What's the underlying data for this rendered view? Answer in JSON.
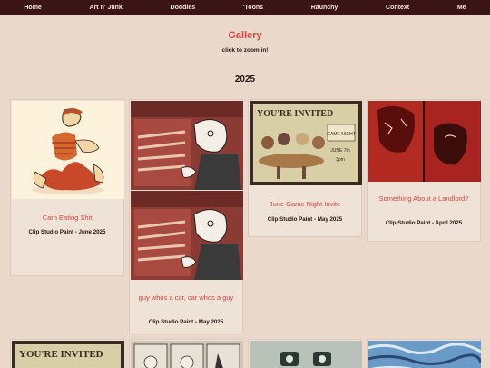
{
  "nav": {
    "items": [
      "Home",
      "Art n' Junk",
      "Doodles",
      "'Toons",
      "Raunchy",
      "Context",
      "Me"
    ]
  },
  "gallery": {
    "title": "Gallery",
    "subtitle": "click to zoom in!",
    "year": "2025"
  },
  "cards": [
    {
      "title": "Carn Eating Shit",
      "meta": "Clip Studio Paint - June 2025"
    },
    {
      "title": "guy whos a car, car whos a guy",
      "meta": "Clip Studio Paint - May 2025"
    },
    {
      "title": "June Game Night Invite",
      "meta": "Clip Studio Paint - May 2025"
    },
    {
      "title": "Something About a Landlord?",
      "meta": "Clip Studio Paint - April 2025"
    }
  ],
  "artwork": {
    "invite_heading": "YOU'RE INVITED",
    "invite_sign": "GAME NIGHT",
    "invite_date": "JUNE 7th",
    "invite_time": "3pm",
    "invite_heading_2": "YOU'RE INVITED"
  },
  "colors": {
    "nav_bg": "#3b1416",
    "accent": "#d64547",
    "page_bg": "#ead9cb"
  }
}
